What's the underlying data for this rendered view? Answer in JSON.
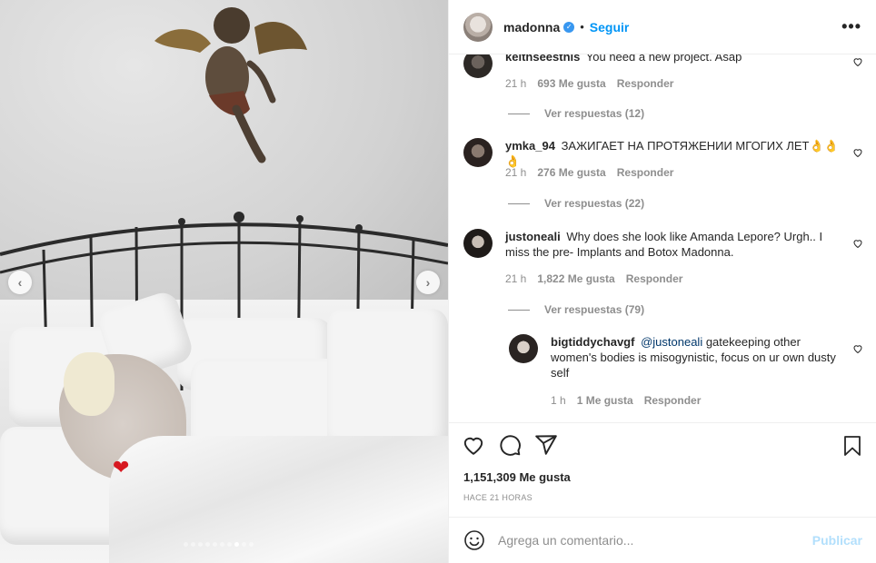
{
  "post": {
    "carousel": {
      "prev_icon": "chevron-left-icon",
      "next_icon": "chevron-right-icon",
      "slide_count": 10,
      "active_slide": 8,
      "overlay_emoji": "❤"
    }
  },
  "header": {
    "username": "madonna",
    "verified_icon": "verified-badge-icon",
    "separator": "•",
    "follow_label": "Seguir",
    "more_label": "•••"
  },
  "comments": [
    {
      "username": "keithseesthis",
      "text": "You need a new project. Asap",
      "time": "21 h",
      "likes": "693 Me gusta",
      "reply_label": "Responder",
      "view_replies": "Ver respuestas (12)"
    },
    {
      "username": "ymka_94",
      "text": "ЗАЖИГАЕТ НА ПРОТЯЖЕНИИ МГОГИХ ЛЕТ👌👌👌",
      "time": "21 h",
      "likes": "276 Me gusta",
      "reply_label": "Responder",
      "view_replies": "Ver respuestas (22)"
    },
    {
      "username": "justoneali",
      "text": "Why does she look like Amanda Lepore? Urgh.. I miss the pre- Implants and Botox Madonna.",
      "time": "21 h",
      "likes": "1,822 Me gusta",
      "reply_label": "Responder",
      "view_replies": "Ver respuestas (79)"
    }
  ],
  "reply": {
    "username": "bigtiddychavgf",
    "mention": "@justoneali",
    "text": "gatekeeping other women's bodies is misogynistic, focus on ur own dusty self",
    "time": "1 h",
    "likes": "1 Me gusta",
    "reply_label": "Responder"
  },
  "actions": {
    "like_icon": "heart-icon",
    "comment_icon": "comment-icon",
    "share_icon": "share-icon",
    "save_icon": "bookmark-icon",
    "like_count": "1,151,309 Me gusta",
    "timestamp": "HACE 21 HORAS"
  },
  "add_comment": {
    "emoji_icon": "emoji-icon",
    "placeholder": "Agrega un comentario...",
    "post_label": "Publicar"
  },
  "colors": {
    "link_blue": "#0095f6",
    "verified_blue": "#3897f0",
    "muted_text": "#8e8e8e",
    "publish_disabled": "#b2dffc"
  }
}
